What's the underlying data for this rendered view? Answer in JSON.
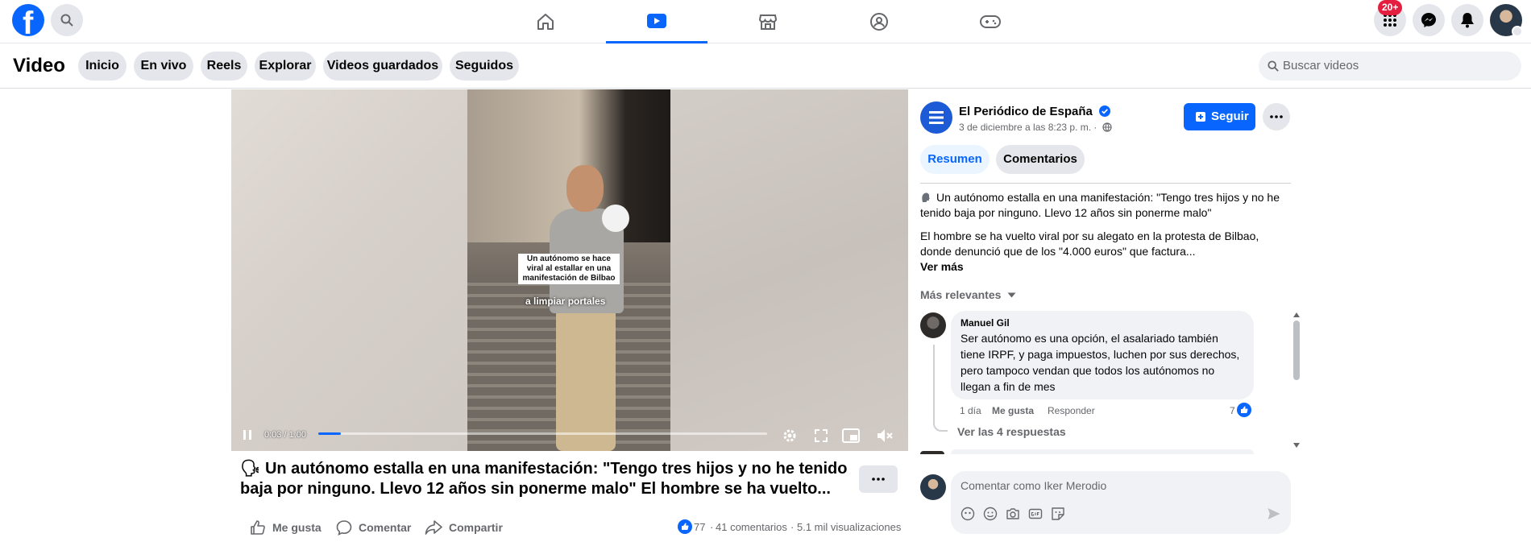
{
  "topbar": {
    "logo_letter": "f",
    "notifications_badge": "20+",
    "nav_tabs": [
      "home-icon",
      "video-icon",
      "marketplace-icon",
      "groups-icon",
      "gaming-icon"
    ],
    "active_tab": 1
  },
  "subbar": {
    "title": "Video",
    "chips": [
      "Inicio",
      "En vivo",
      "Reels",
      "Explorar",
      "Videos guardados",
      "Seguidos"
    ],
    "search_placeholder": "Buscar videos"
  },
  "video": {
    "overlay_caption": "Un autónomo se hace viral al estallar en una manifestación de Bilbao",
    "subtitle": "a limpiar portales",
    "time": "0:03 / 1:00",
    "progress": 0.05
  },
  "post": {
    "title_emoji": "🗣",
    "title": "Un autónomo estalla en una manifestación: \"Tengo tres hijos y no he tenido baja por ninguno. Llevo 12 años sin ponerme malo\" El hombre se ha vuelto...",
    "actions": [
      "Me gusta",
      "Comentar",
      "Compartir"
    ],
    "likes": "77",
    "comments": "41 comentarios",
    "views": "5.1 mil visualizaciones"
  },
  "sidebar": {
    "page_name": "El Periódico de España",
    "date": "3 de diciembre a las 8:23 p. m. ·",
    "follow_label": "Seguir",
    "tabs": [
      "Resumen",
      "Comentarios"
    ],
    "description_line1": "Un autónomo estalla en una manifestación: \"Tengo tres hijos y no he tenido baja por ninguno. Llevo 12 años sin ponerme malo\"",
    "description_line2": "El hombre se ha vuelto viral por su alegato en la protesta de Bilbao, donde denunció que de los \"4.000 euros\" que factura...",
    "see_more": "Ver más",
    "sort_label": "Más relevantes",
    "comment": {
      "author": "Manuel Gil",
      "text": "Ser autónomo es una opción, el asalariado también tiene IRPF, y paga impuestos, luchen por sus derechos, pero tampoco vendan que todos los autónomos no llegan a fin de mes",
      "age": "1 día",
      "like": "Me gusta",
      "reply": "Responder",
      "reactions": "7",
      "replies_link": "Ver las 4 respuestas"
    },
    "comment_placeholder": "Comentar como Iker Merodio"
  },
  "colors": {
    "accent": "#0866ff",
    "chip_bg": "#e4e6eb",
    "secondary_text": "#65676b"
  }
}
